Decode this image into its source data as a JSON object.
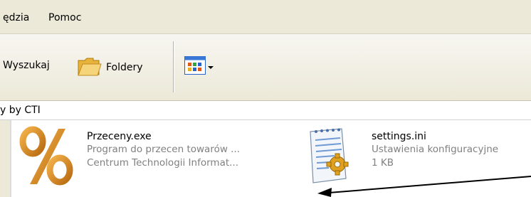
{
  "menu": {
    "items": [
      "ędzia",
      "Pomoc"
    ]
  },
  "toolbar": {
    "search_label": "Wyszukaj",
    "folders_label": "Foldery",
    "views_icon": "views-grid-icon"
  },
  "address": {
    "text": "y by CTI"
  },
  "files": [
    {
      "name": "Przeceny.exe",
      "line1": "Program do przecen towarów ...",
      "line2": "Centrum Technologii Informat...",
      "icon": "percent-icon"
    },
    {
      "name": "settings.ini",
      "line1": "Ustawienia konfiguracyjne",
      "line2": "1 KB",
      "icon": "settings-file-icon"
    }
  ],
  "colors": {
    "chrome": "#ece9d8",
    "percent_orange": "#d68a1a",
    "secondary_text": "#808080"
  }
}
